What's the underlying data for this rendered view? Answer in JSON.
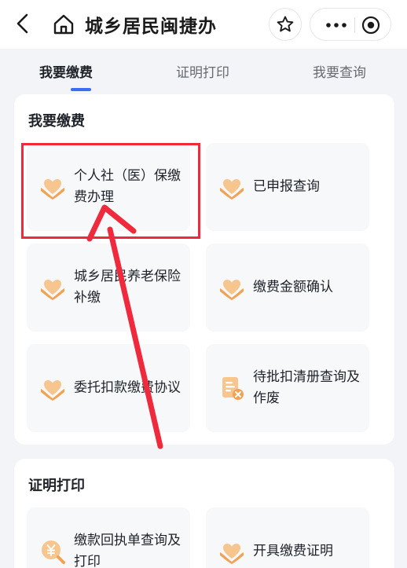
{
  "nav": {
    "title": "城乡居民闽捷办",
    "icons": [
      "back-arrow-icon",
      "home-icon",
      "star-icon",
      "more-dots-icon",
      "target-icon"
    ]
  },
  "tabs": [
    {
      "label": "我要缴费",
      "active": true
    },
    {
      "label": "证明打印",
      "active": false
    },
    {
      "label": "我要查询",
      "active": false
    }
  ],
  "sections": {
    "payment": {
      "title": "我要缴费",
      "items": [
        {
          "label": "个人社（医）保缴费办理",
          "icon": "heart-hand-icon"
        },
        {
          "label": "已申报查询",
          "icon": "heart-hand-icon"
        },
        {
          "label": "城乡居民养老保险补缴",
          "icon": "heart-hand-icon"
        },
        {
          "label": "缴费金额确认",
          "icon": "heart-hand-icon"
        },
        {
          "label": "委托扣款缴费协议",
          "icon": "heart-hand-icon"
        },
        {
          "label": "待批扣清册查询及作废",
          "icon": "document-cancel-icon"
        }
      ]
    },
    "certificate": {
      "title": "证明打印",
      "items": [
        {
          "label": "缴款回执单查询及打印",
          "icon": "yuan-search-icon"
        },
        {
          "label": "开具缴费证明",
          "icon": "heart-hand-icon"
        }
      ]
    }
  },
  "colors": {
    "accent": "#3a6cf4",
    "icon_orange": "#f2a255",
    "annotation_red": "#ee2a3c"
  }
}
